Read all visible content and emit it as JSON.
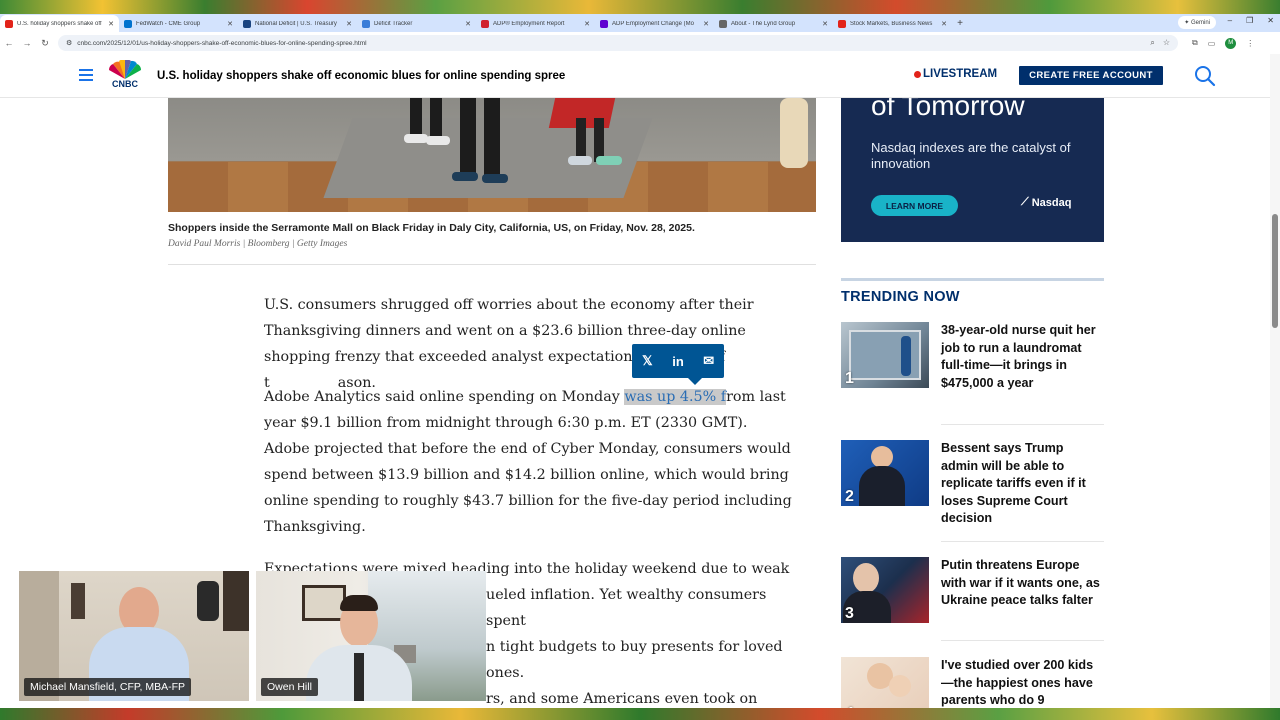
{
  "browser": {
    "tabs": [
      {
        "label": "U.S. holiday shoppers shake off",
        "color": "#e2231a",
        "active": true
      },
      {
        "label": "FedWatch - CME Group",
        "color": "#0072ce",
        "active": false
      },
      {
        "label": "National Deficit | U.S. Treasury",
        "color": "#1a4480",
        "active": false
      },
      {
        "label": "Deficit Tracker",
        "color": "#3b7dd8",
        "active": false
      },
      {
        "label": "ADP® Employment Report",
        "color": "#d0202e",
        "active": false
      },
      {
        "label": "ADP Employment Change (Mo",
        "color": "#5f01d1",
        "active": false
      },
      {
        "label": "About - The Lynd Group",
        "color": "#666666",
        "active": false
      },
      {
        "label": "Stock Markets, Business News",
        "color": "#e2231a",
        "active": false
      }
    ],
    "gemini_label": "Gemini",
    "url": "cnbc.com/2025/12/01/us-holiday-shoppers-shake-off-economic-blues-for-online-spending-spree.html",
    "profile_initial": "M"
  },
  "header": {
    "logo_text": "CNBC",
    "headline": "U.S. holiday shoppers shake off economic blues for online spending spree",
    "livestream_label": "LIVESTREAM",
    "create_account_label": "CREATE FREE ACCOUNT"
  },
  "article": {
    "caption": "Shoppers inside the Serramonte Mall on Black Friday in Daly City, California, US, on Friday, Nov. 28, 2025.",
    "credit": "David Paul Morris | Bloomberg | Getty Images",
    "p1": "U.S. consumers shrugged off worries about the economy after their Thanksgiving dinners and went on a $23.6 billion three-day online shopping frenzy that exceeded analyst expectations, kicking off t",
    "p1_end": "ason.",
    "p2_before": "Adobe Analytics said online spending on Monday ",
    "p2_highlight": "was up 4.5% f",
    "p2_after": "rom last year $9.1 billion from midnight through 6:30 p.m. ET (2330 GMT). Adobe projected that before the end of Cyber Monday, consumers would spend between $13.9 billion and $14.2 billion online, which would bring online spending to roughly $43.7 billion for the five-day period including Thanksgiving.",
    "p3_line1": "Expectations were mixed heading into the holiday weekend due to weak",
    "p3_line2": "ueled inflation. Yet wealthy consumers spent",
    "p3_line3": "n tight budgets to buy presents for loved ones.",
    "p3_line4": "rs, and some Americans even took on short-"
  },
  "share": {
    "x_label": "𝕏",
    "linkedin_label": "in",
    "email_label": "✉"
  },
  "ad": {
    "headline": "of Tomorrow",
    "text": "Nasdaq indexes are the catalyst of innovation",
    "button": "LEARN MORE",
    "brand": "Nasdaq"
  },
  "trending": {
    "title": "TRENDING NOW",
    "items": [
      {
        "num": "1",
        "text": "38-year-old nurse quit her job to run a laundromat full-time—it brings in $475,000 a year"
      },
      {
        "num": "2",
        "text": "Bessent says Trump admin will be able to replicate tariffs even if it loses Supreme Court decision"
      },
      {
        "num": "3",
        "text": "Putin threatens Europe with war if it wants one, as Ukraine peace talks falter"
      },
      {
        "num": "4",
        "text": "I've studied over 200 kids—the happiest ones have parents who do 9"
      }
    ]
  },
  "webcams": {
    "cam1_name": "Michael Mansfield, CFP, MBA-FP",
    "cam2_name": "Owen Hill"
  }
}
